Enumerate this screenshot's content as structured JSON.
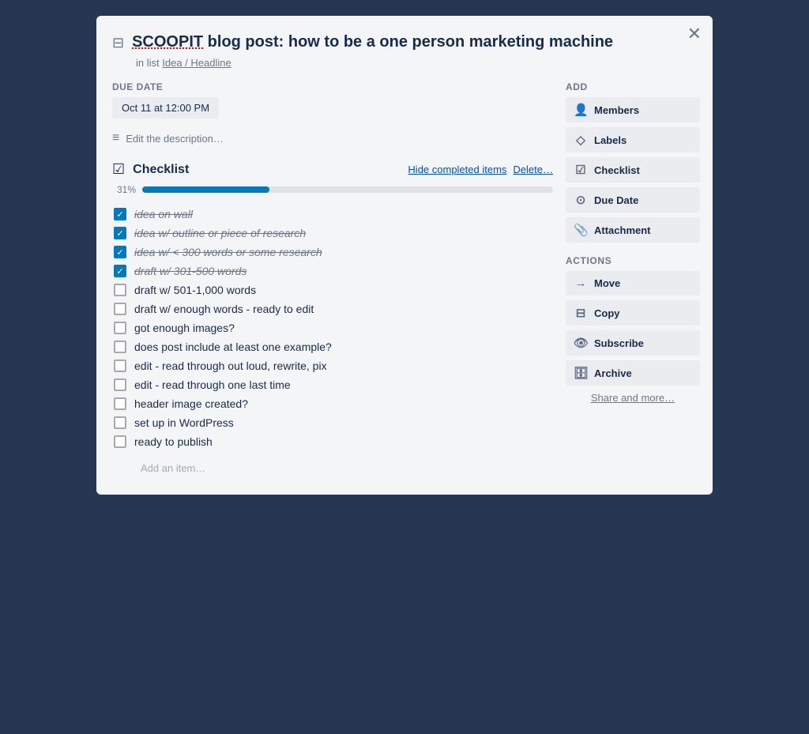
{
  "modal": {
    "title_brand": "SCOOPIT",
    "title_rest": " blog post: how to be a one person marketing machine",
    "list_label": "in list",
    "list_name": "Idea / Headline",
    "close_label": "✕"
  },
  "due_date": {
    "section_label": "Due Date",
    "value": "Oct 11 at 12:00 PM"
  },
  "description": {
    "placeholder": "Edit the description…"
  },
  "checklist": {
    "title": "Checklist",
    "hide_label": "Hide completed items",
    "delete_label": "Delete…",
    "progress_pct": "31%",
    "progress_value": 31,
    "items": [
      {
        "id": 1,
        "text": "idea on wall",
        "completed": true
      },
      {
        "id": 2,
        "text": "idea w/ outline or piece of research",
        "completed": true
      },
      {
        "id": 3,
        "text": "idea w/ < 300 words or some research",
        "completed": true
      },
      {
        "id": 4,
        "text": "draft w/ 301-500 words",
        "completed": true
      },
      {
        "id": 5,
        "text": "draft w/ 501-1,000 words",
        "completed": false
      },
      {
        "id": 6,
        "text": "draft w/ enough words - ready to edit",
        "completed": false
      },
      {
        "id": 7,
        "text": "got enough images?",
        "completed": false
      },
      {
        "id": 8,
        "text": "does post include at least one example?",
        "completed": false
      },
      {
        "id": 9,
        "text": "edit - read through out loud, rewrite, pix",
        "completed": false
      },
      {
        "id": 10,
        "text": "edit - read through one last time",
        "completed": false
      },
      {
        "id": 11,
        "text": "header image created?",
        "completed": false
      },
      {
        "id": 12,
        "text": "set up in WordPress",
        "completed": false
      },
      {
        "id": 13,
        "text": "ready to publish",
        "completed": false
      }
    ],
    "add_placeholder": "Add an item…"
  },
  "sidebar": {
    "add_section_title": "Add",
    "add_buttons": [
      {
        "id": "members",
        "icon": "👤",
        "label": "Members"
      },
      {
        "id": "labels",
        "icon": "◇",
        "label": "Labels"
      },
      {
        "id": "checklist",
        "icon": "☑",
        "label": "Checklist"
      },
      {
        "id": "due-date",
        "icon": "⊙",
        "label": "Due Date"
      },
      {
        "id": "attachment",
        "icon": "📎",
        "label": "Attachment"
      }
    ],
    "actions_section_title": "Actions",
    "action_buttons": [
      {
        "id": "move",
        "icon": "→",
        "label": "Move"
      },
      {
        "id": "copy",
        "icon": "⊟",
        "label": "Copy"
      },
      {
        "id": "subscribe",
        "icon": "👁",
        "label": "Subscribe"
      },
      {
        "id": "archive",
        "icon": "🗄",
        "label": "Archive"
      }
    ],
    "share_label": "Share and more…"
  }
}
